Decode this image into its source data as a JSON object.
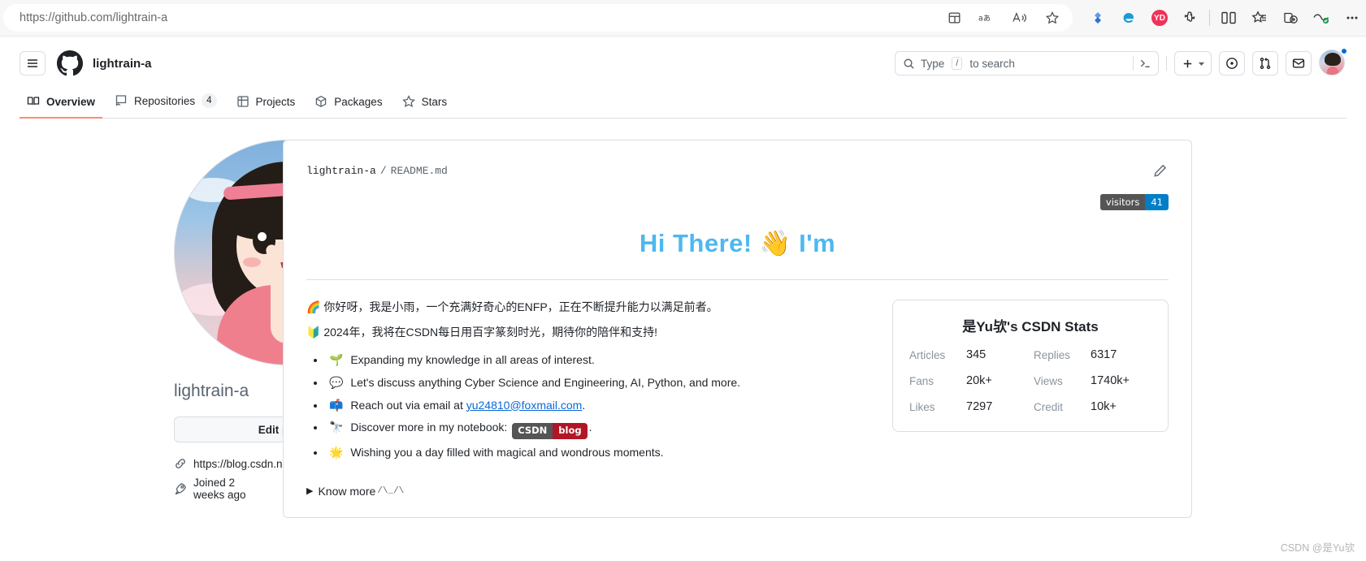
{
  "browser": {
    "url_prefix": "https://",
    "url_domain": "github.com",
    "url_path": "/lightrain-a",
    "url_full": "https://github.com/lightrain-a",
    "icons": [
      "split-screen-icon",
      "translate-icon",
      "read-aloud-icon",
      "favorite-star-icon"
    ],
    "extension_icons": [
      "diamond-extension-icon",
      "internet-explorer-icon",
      "youdao-extension-icon",
      "puzzle-extensions-icon"
    ],
    "right_icons": [
      "split-screen-icon",
      "collections-icon",
      "add-tab-group-icon",
      "browser-essentials-icon",
      "settings-more-icon"
    ],
    "youdao_badge": "YD"
  },
  "header": {
    "menu_icon": "hamburger-menu-icon",
    "logo_icon": "github-mark-icon",
    "owner": "lightrain-a",
    "search": {
      "icon": "search-icon",
      "placeholder_prefix": "Type",
      "placeholder_key": "/",
      "placeholder_suffix": "to search",
      "terminal_icon": "command-palette-icon"
    },
    "create_button": {
      "icon": "plus-icon",
      "chevron": "chevron-down-icon"
    },
    "issues_icon": "issues-dot-icon",
    "pull_requests_icon": "git-pull-request-icon",
    "inbox_icon": "inbox-mail-icon",
    "avatar": "user-avatar",
    "tabs": [
      {
        "label": "Overview",
        "icon": "book-icon",
        "count": null,
        "active": true
      },
      {
        "label": "Repositories",
        "icon": "repo-icon",
        "count": "4",
        "active": false
      },
      {
        "label": "Projects",
        "icon": "project-icon",
        "count": null,
        "active": false
      },
      {
        "label": "Packages",
        "icon": "package-cube-icon",
        "count": null,
        "active": false
      },
      {
        "label": "Stars",
        "icon": "star-icon",
        "count": null,
        "active": false
      }
    ]
  },
  "profile": {
    "avatar_name": "profile-avatar-anime-girl",
    "emoji_status_icon": "smiley-face-icon",
    "username": "lightrain-a",
    "edit_button": "Edit profile",
    "meta": [
      {
        "icon": "link-icon",
        "text": "https://blog.csdn.net/WTYuong"
      },
      {
        "icon": "rocket-icon",
        "text": "Joined 2 weeks ago"
      }
    ]
  },
  "readme": {
    "owner": "lightrain-a",
    "separator": "/",
    "filename": "README.md",
    "edit_icon": "pencil-edit-icon",
    "visitors_badge": {
      "label": "visitors",
      "value": "41",
      "label_color": "#555555",
      "value_color": "#007ec6"
    },
    "heading": "Hi There!",
    "heading_emoji": "👋",
    "heading_suffix": "I'm",
    "heading_color": "#4db8f0",
    "intro_lines": [
      {
        "emoji": "🌈",
        "text": "你好呀，我是小雨，一个充满好奇心的ENFP，正在不断提升能力以满足前者。"
      },
      {
        "emoji": "🔰",
        "text": "2024年，我将在CSDN每日用百字篆刻时光，期待你的陪伴和支持!"
      }
    ],
    "bullets": [
      {
        "emoji": "🌱",
        "text": "Expanding my knowledge in all areas of interest.",
        "link": null,
        "badge": null,
        "tail": ""
      },
      {
        "emoji": "💬",
        "text": "Let's discuss anything Cyber Science and Engineering, AI, Python, and more.",
        "link": null,
        "badge": null,
        "tail": ""
      },
      {
        "emoji": "📫",
        "text": "Reach out via email at ",
        "link": "yu24810@foxmail.com",
        "badge": null,
        "tail": "."
      },
      {
        "emoji": "🔭",
        "text": "Discover more in my notebook: ",
        "link": null,
        "badge": {
          "label": "CSDN",
          "value": "blog",
          "label_color": "#555555",
          "value_color": "#b01626"
        },
        "tail": "."
      },
      {
        "emoji": "🌟",
        "text": "Wishing you a day filled with magical and wondrous moments.",
        "link": null,
        "badge": null,
        "tail": ""
      }
    ],
    "know_more": {
      "triangle": "▶",
      "label": "Know more",
      "ascii_cat": "/\\_/\\"
    }
  },
  "stats_card": {
    "title": "是Yu欤's CSDN Stats",
    "rows": [
      {
        "k1": "Articles",
        "v1": "345",
        "k2": "Replies",
        "v2": "6317"
      },
      {
        "k1": "Fans",
        "v1": "20k+",
        "k2": "Views",
        "v2": "1740k+"
      },
      {
        "k1": "Likes",
        "v1": "7297",
        "k2": "Credit",
        "v2": "10k+"
      }
    ]
  },
  "watermark": "CSDN @是Yu欤"
}
